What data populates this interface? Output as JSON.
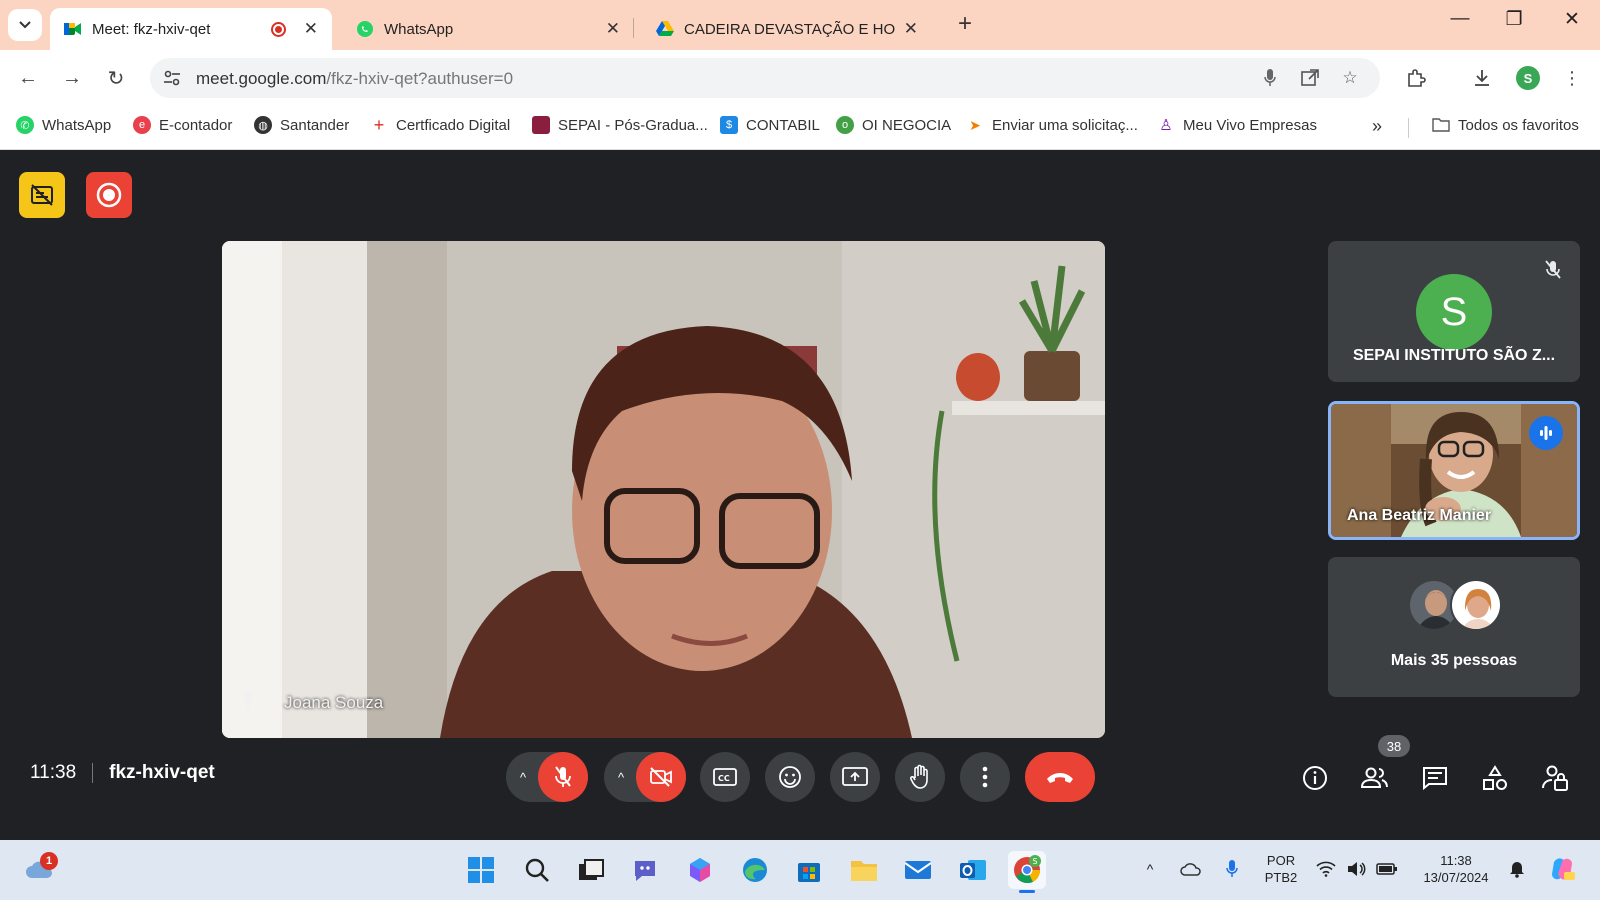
{
  "browser": {
    "tabs": [
      {
        "title": "Meet: fkz-hxiv-qet",
        "active": true,
        "recording": true
      },
      {
        "title": "WhatsApp",
        "active": false
      },
      {
        "title": "CADEIRA DEVASTAÇÃO E HORF",
        "active": false
      }
    ],
    "url_host": "meet.google.com",
    "url_path": "/fkz-hxiv-qet?authuser=0",
    "profile_initial": "S",
    "bookmarks": [
      {
        "label": "WhatsApp",
        "icon": "whatsapp-icon",
        "color": "#25d366"
      },
      {
        "label": "E-contador",
        "icon": "econtador-icon",
        "color": "#e8414d"
      },
      {
        "label": "Santander",
        "icon": "globe-icon",
        "color": "#333333"
      },
      {
        "label": "Certficado Digital",
        "icon": "plus-icon",
        "color": "#d93025"
      },
      {
        "label": "SEPAI - Pós-Gradua...",
        "icon": "sepai-icon",
        "color": "#8b1e3f"
      },
      {
        "label": "CONTABIL",
        "icon": "contabil-icon",
        "color": "#1e88e5"
      },
      {
        "label": "OI NEGOCIA",
        "icon": "oi-icon",
        "color": "#43a047"
      },
      {
        "label": "Enviar uma solicitaç...",
        "icon": "send-icon",
        "color": "#f57c00"
      },
      {
        "label": "Meu Vivo Empresas",
        "icon": "vivo-icon",
        "color": "#7b1fa2"
      }
    ],
    "bookmarks_more": "»",
    "all_bookmarks": "Todos os favoritos"
  },
  "meet": {
    "main_participant": "Joana Souza",
    "participants": [
      {
        "name": "SEPAI INSTITUTO SÃO Z...",
        "avatar_initial": "S",
        "muted": true
      },
      {
        "name": "Ana Beatriz Manier",
        "speaking": true
      }
    ],
    "more_people": "Mais 35 pessoas",
    "time": "11:38",
    "meeting_code": "fkz-hxiv-qet",
    "participant_count": "38",
    "colors": {
      "accent": "#8ab4f8",
      "danger": "#ea4335",
      "background": "#202124",
      "tile": "#3c4043"
    }
  },
  "taskbar": {
    "weather_badge": "1",
    "language_top": "POR",
    "language_bottom": "PTB2",
    "clock_time": "11:38",
    "clock_date": "13/07/2024",
    "chrome_badge": "S"
  }
}
